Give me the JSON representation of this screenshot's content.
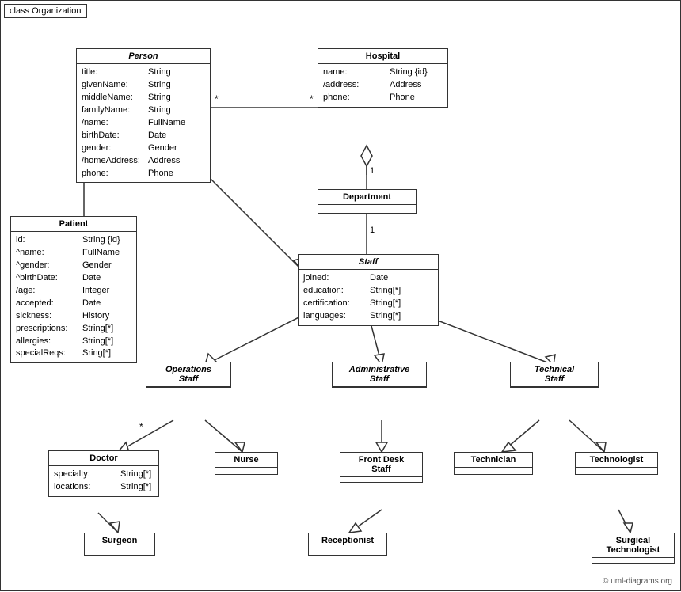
{
  "diagram": {
    "title": "class Organization",
    "classes": {
      "person": {
        "name": "Person",
        "italic": true,
        "attrs": [
          {
            "name": "title:",
            "type": "String"
          },
          {
            "name": "givenName:",
            "type": "String"
          },
          {
            "name": "middleName:",
            "type": "String"
          },
          {
            "name": "familyName:",
            "type": "String"
          },
          {
            "name": "/name:",
            "type": "FullName"
          },
          {
            "name": "birthDate:",
            "type": "Date"
          },
          {
            "name": "gender:",
            "type": "Gender"
          },
          {
            "name": "/homeAddress:",
            "type": "Address"
          },
          {
            "name": "phone:",
            "type": "Phone"
          }
        ]
      },
      "hospital": {
        "name": "Hospital",
        "italic": false,
        "attrs": [
          {
            "name": "name:",
            "type": "String {id}"
          },
          {
            "name": "/address:",
            "type": "Address"
          },
          {
            "name": "phone:",
            "type": "Phone"
          }
        ]
      },
      "patient": {
        "name": "Patient",
        "italic": false,
        "attrs": [
          {
            "name": "id:",
            "type": "String {id}"
          },
          {
            "name": "^name:",
            "type": "FullName"
          },
          {
            "name": "^gender:",
            "type": "Gender"
          },
          {
            "name": "^birthDate:",
            "type": "Date"
          },
          {
            "name": "/age:",
            "type": "Integer"
          },
          {
            "name": "accepted:",
            "type": "Date"
          },
          {
            "name": "sickness:",
            "type": "History"
          },
          {
            "name": "prescriptions:",
            "type": "String[*]"
          },
          {
            "name": "allergies:",
            "type": "String[*]"
          },
          {
            "name": "specialReqs:",
            "type": "Sring[*]"
          }
        ]
      },
      "department": {
        "name": "Department",
        "italic": false,
        "attrs": []
      },
      "staff": {
        "name": "Staff",
        "italic": true,
        "attrs": [
          {
            "name": "joined:",
            "type": "Date"
          },
          {
            "name": "education:",
            "type": "String[*]"
          },
          {
            "name": "certification:",
            "type": "String[*]"
          },
          {
            "name": "languages:",
            "type": "String[*]"
          }
        ]
      },
      "operations_staff": {
        "name": "Operations Staff",
        "italic": true
      },
      "administrative_staff": {
        "name": "Administrative Staff",
        "italic": true
      },
      "technical_staff": {
        "name": "Technical Staff",
        "italic": true
      },
      "doctor": {
        "name": "Doctor",
        "italic": false,
        "attrs": [
          {
            "name": "specialty:",
            "type": "String[*]"
          },
          {
            "name": "locations:",
            "type": "String[*]"
          }
        ]
      },
      "nurse": {
        "name": "Nurse",
        "italic": false,
        "attrs": []
      },
      "front_desk_staff": {
        "name": "Front Desk Staff",
        "italic": false,
        "attrs": []
      },
      "technician": {
        "name": "Technician",
        "italic": false,
        "attrs": []
      },
      "technologist": {
        "name": "Technologist",
        "italic": false,
        "attrs": []
      },
      "surgeon": {
        "name": "Surgeon",
        "italic": false,
        "attrs": []
      },
      "receptionist": {
        "name": "Receptionist",
        "italic": false,
        "attrs": []
      },
      "surgical_technologist": {
        "name": "Surgical Technologist",
        "italic": false,
        "attrs": []
      }
    },
    "copyright": "© uml-diagrams.org"
  }
}
